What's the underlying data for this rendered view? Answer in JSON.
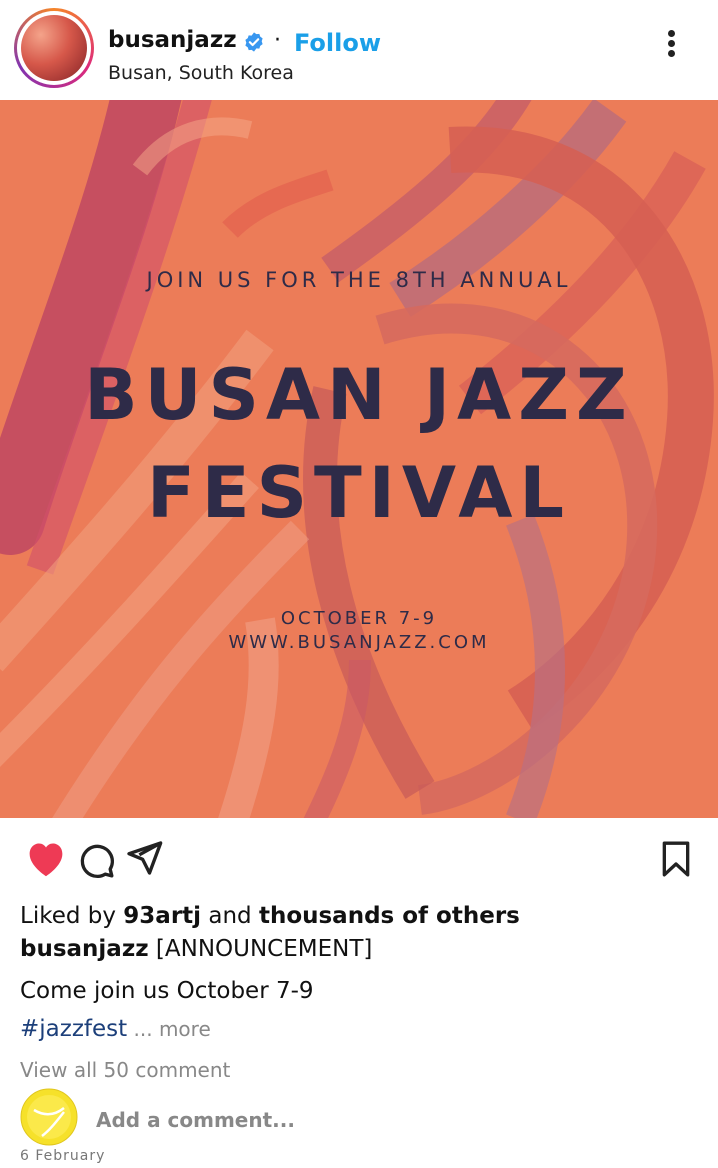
{
  "header": {
    "username": "busanjazz",
    "separator": "·",
    "follow_label": "Follow",
    "location": "Busan, South Korea"
  },
  "poster": {
    "line1": "JOIN US FOR THE 8TH ANNUAL",
    "title_line1": "BUSAN JAZZ",
    "title_line2": "FESTIVAL",
    "dates": "OCTOBER 7-9",
    "url": "WWW.BUSANJAZZ.COM"
  },
  "engagement": {
    "liked_prefix": "Liked by ",
    "liked_user": "93artj",
    "liked_middle": " and ",
    "liked_suffix": "thousands of others"
  },
  "caption": {
    "username": "busanjazz",
    "text": " [ANNOUNCEMENT]",
    "body": "Come join us October 7-9",
    "hashtag": "#jazzfest",
    "more": " ... more"
  },
  "comments": {
    "view_all": "View all 50 comment",
    "add_placeholder": "Add a comment..."
  },
  "post_date": "6 February",
  "icons": {
    "verified": "verified-badge-icon",
    "heart": "heart-icon",
    "comment": "comment-icon",
    "share": "share-icon",
    "bookmark": "bookmark-icon",
    "more": "more-vertical-icon"
  },
  "colors": {
    "follow": "#1a9fe8",
    "heart": "#ee3a55",
    "poster_bg": "#ec7c58",
    "poster_text": "#2e2b48",
    "hashtag": "#1c3f7a"
  }
}
